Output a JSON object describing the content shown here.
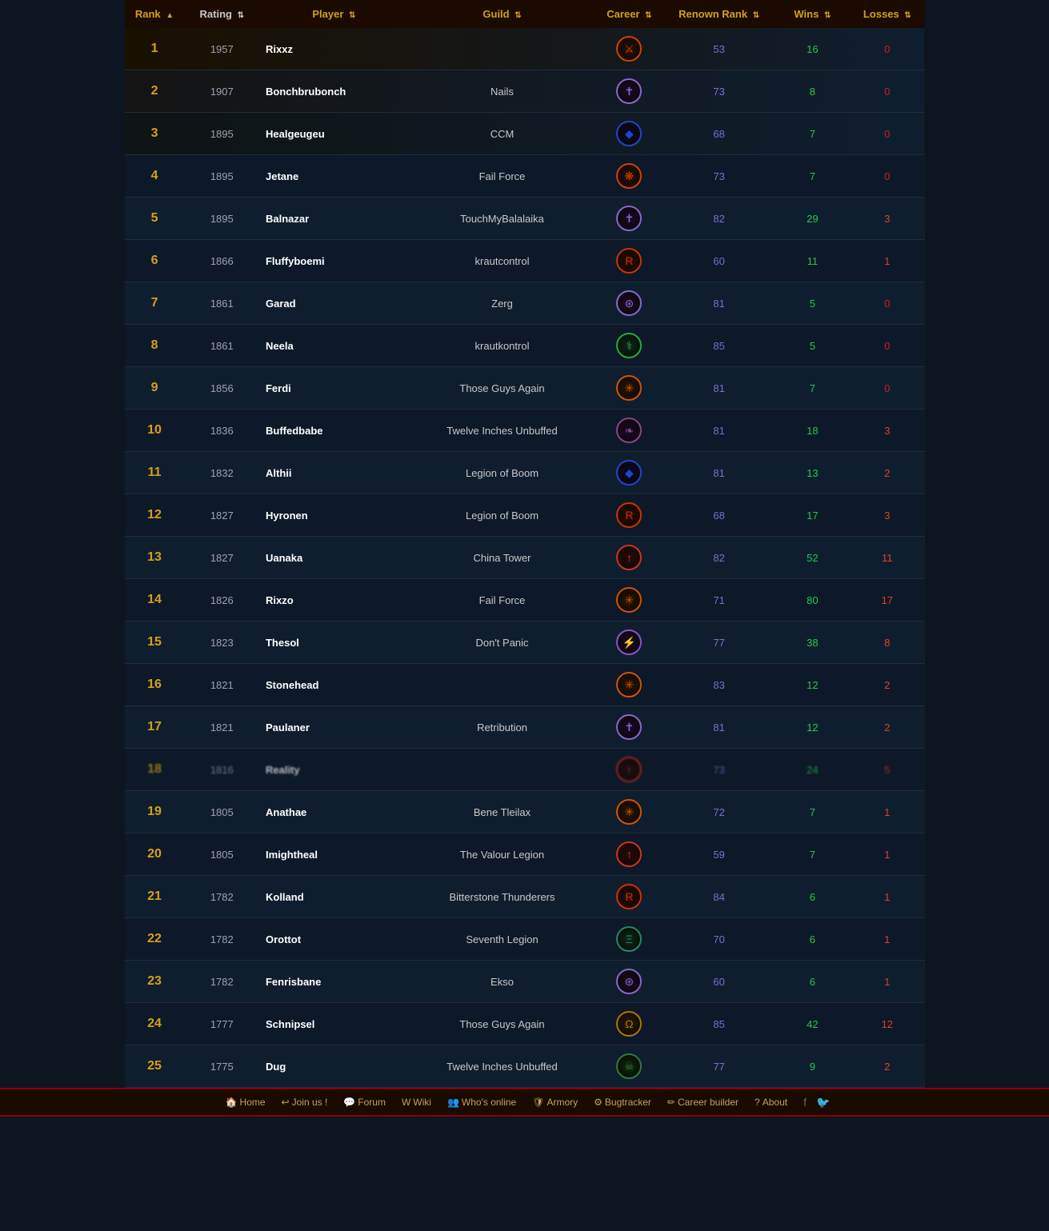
{
  "header": {
    "columns": [
      {
        "key": "rank",
        "label": "Rank",
        "sortable": true,
        "active": true
      },
      {
        "key": "rating",
        "label": "Rating",
        "sortable": true
      },
      {
        "key": "player",
        "label": "Player",
        "sortable": true
      },
      {
        "key": "guild",
        "label": "Guild",
        "sortable": true
      },
      {
        "key": "career",
        "label": "Career",
        "sortable": true
      },
      {
        "key": "renown",
        "label": "Renown Rank",
        "sortable": true
      },
      {
        "key": "wins",
        "label": "Wins",
        "sortable": true
      },
      {
        "key": "losses",
        "label": "Losses",
        "sortable": true
      }
    ]
  },
  "navbar": {
    "items": [
      {
        "label": "Home",
        "icon": "🏠"
      },
      {
        "label": "Join us !",
        "icon": "➕"
      },
      {
        "label": "Forum",
        "icon": "💬"
      },
      {
        "label": "Wiki",
        "icon": "W"
      },
      {
        "label": "Who's online",
        "icon": "👥"
      },
      {
        "label": "Armory",
        "icon": "🛡"
      },
      {
        "label": "Bugtracker",
        "icon": "⚙"
      },
      {
        "label": "Career builder",
        "icon": "✏"
      },
      {
        "label": "About",
        "icon": "?"
      }
    ],
    "social": [
      "f",
      "🐦"
    ]
  },
  "rows": [
    {
      "rank": 1,
      "rating": 1957,
      "player": "Rixxz",
      "guild": "",
      "career_icon": "⚔",
      "renown": 53,
      "wins": 16,
      "losses": 0
    },
    {
      "rank": 2,
      "rating": 1907,
      "player": "Bonchbrubonch",
      "guild": "Nails",
      "career_icon": "✝",
      "renown": 73,
      "wins": 8,
      "losses": 0
    },
    {
      "rank": 3,
      "rating": 1895,
      "player": "Healgeugeu",
      "guild": "CCM",
      "career_icon": "💎",
      "renown": 68,
      "wins": 7,
      "losses": 0
    },
    {
      "rank": 4,
      "rating": 1895,
      "player": "Jetane",
      "guild": "Fail Force",
      "career_icon": "🔥",
      "renown": 73,
      "wins": 7,
      "losses": 0
    },
    {
      "rank": 5,
      "rating": 1895,
      "player": "Balnazar",
      "guild": "TouchMyBalalaika",
      "career_icon": "✝",
      "renown": 82,
      "wins": 29,
      "losses": 3
    },
    {
      "rank": 6,
      "rating": 1866,
      "player": "Fluffyboemi",
      "guild": "krautcontrol",
      "career_icon": "R",
      "renown": 60,
      "wins": 11,
      "losses": 1
    },
    {
      "rank": 7,
      "rating": 1861,
      "player": "Garad",
      "guild": "Zerg",
      "career_icon": "⏰",
      "renown": 81,
      "wins": 5,
      "losses": 0
    },
    {
      "rank": 8,
      "rating": 1861,
      "player": "Neela",
      "guild": "krautkontrol",
      "career_icon": "🌿",
      "renown": 85,
      "wins": 5,
      "losses": 0
    },
    {
      "rank": 9,
      "rating": 1856,
      "player": "Ferdi",
      "guild": "Those Guys Again",
      "career_icon": "✳",
      "renown": 81,
      "wins": 7,
      "losses": 0
    },
    {
      "rank": 10,
      "rating": 1836,
      "player": "Buffedbabe",
      "guild": "Twelve Inches Unbuffed",
      "career_icon": "💜",
      "renown": 81,
      "wins": 18,
      "losses": 3
    },
    {
      "rank": 11,
      "rating": 1832,
      "player": "Althii",
      "guild": "Legion of Boom",
      "career_icon": "💎",
      "renown": 81,
      "wins": 13,
      "losses": 2
    },
    {
      "rank": 12,
      "rating": 1827,
      "player": "Hyronen",
      "guild": "Legion of Boom",
      "career_icon": "R",
      "renown": 68,
      "wins": 17,
      "losses": 3
    },
    {
      "rank": 13,
      "rating": 1827,
      "player": "Uanaka",
      "guild": "China Tower",
      "career_icon": "↑",
      "renown": 82,
      "wins": 52,
      "losses": 11
    },
    {
      "rank": 14,
      "rating": 1826,
      "player": "Rixzo",
      "guild": "Fail Force",
      "career_icon": "✳",
      "renown": 71,
      "wins": 80,
      "losses": 17
    },
    {
      "rank": 15,
      "rating": 1823,
      "player": "Thesol",
      "guild": "Don't Panic",
      "career_icon": "⚡",
      "renown": 77,
      "wins": 38,
      "losses": 8
    },
    {
      "rank": 16,
      "rating": 1821,
      "player": "Stonehead",
      "guild": "",
      "career_icon": "✳",
      "renown": 83,
      "wins": 12,
      "losses": 2
    },
    {
      "rank": 17,
      "rating": 1821,
      "player": "Paulaner",
      "guild": "Retribution",
      "career_icon": "✝",
      "renown": 81,
      "wins": 12,
      "losses": 2
    },
    {
      "rank": 18,
      "rating": 1816,
      "player": "Reality",
      "guild": "",
      "career_icon": "↑",
      "renown": 73,
      "wins": 24,
      "losses": 5,
      "blurred": true
    },
    {
      "rank": 19,
      "rating": 1805,
      "player": "Anathae",
      "guild": "Bene Tleilax",
      "career_icon": "✳",
      "renown": 72,
      "wins": 7,
      "losses": 1
    },
    {
      "rank": 20,
      "rating": 1805,
      "player": "Imightheal",
      "guild": "The Valour Legion",
      "career_icon": "↑",
      "renown": 59,
      "wins": 7,
      "losses": 1
    },
    {
      "rank": 21,
      "rating": 1782,
      "player": "Kolland",
      "guild": "Bitterstone Thunderers",
      "career_icon": "R",
      "renown": 84,
      "wins": 6,
      "losses": 1
    },
    {
      "rank": 22,
      "rating": 1782,
      "player": "Orottot",
      "guild": "Seventh Legion",
      "career_icon": "E",
      "renown": 70,
      "wins": 6,
      "losses": 1
    },
    {
      "rank": 23,
      "rating": 1782,
      "player": "Fenrisbane",
      "guild": "Ekso",
      "career_icon": "⏰",
      "renown": 60,
      "wins": 6,
      "losses": 1
    },
    {
      "rank": 24,
      "rating": 1777,
      "player": "Schnipsel",
      "guild": "Those Guys Again",
      "career_icon": "Ω",
      "renown": 85,
      "wins": 42,
      "losses": 12
    },
    {
      "rank": 25,
      "rating": 1775,
      "player": "Dug",
      "guild": "Twelve Inches Unbuffed",
      "career_icon": "👾",
      "renown": 77,
      "wins": 9,
      "losses": 2
    }
  ],
  "career_colors": {
    "⚔": "#cc4400",
    "✝": "#8866cc",
    "💎": "#2244cc",
    "🔥": "#cc4400",
    "R": "#cc3300",
    "⏰": "#8866cc",
    "🌿": "#22aa44",
    "✳": "#cc5500",
    "💜": "#884488",
    "↑": "#cc3322",
    "⚡": "#8855cc",
    "E": "#228866",
    "Ω": "#aa7700",
    "👾": "#337744"
  }
}
